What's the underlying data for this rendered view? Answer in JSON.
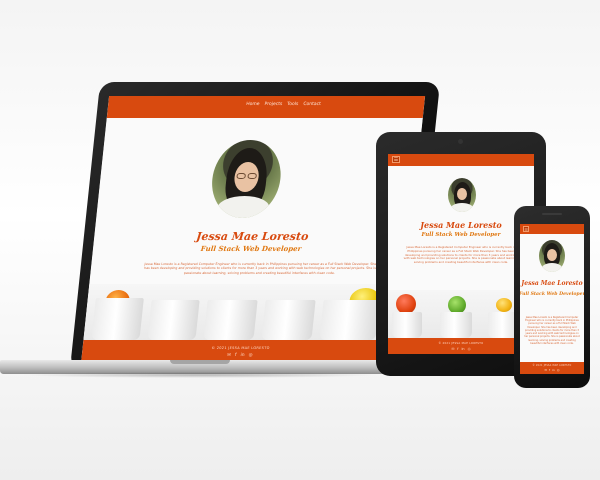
{
  "site": {
    "name": "Jessa Mae Loresto",
    "role": "Full Stack Web Developer",
    "nav": [
      "Home",
      "Projects",
      "Tools",
      "Contact"
    ],
    "menu_icon": "hamburger-icon",
    "description": "Jessa Mae Loresto is a Registered Computer Engineer who is currently back in Philippines pursuing her career as a Full Stack Web Developer. She has been developing and providing solutions to clients for more than 3 years and working with web technologies on her personal projects. She is passionate about learning, solving problems and creating beautiful interfaces with clean code.",
    "copyright": "© 2021 JESSA MAE LORESTO",
    "social_icons": [
      "email-icon",
      "facebook-icon",
      "linkedin-icon",
      "github-icon"
    ],
    "social_glyphs": [
      "✉",
      "f",
      "in",
      "◎"
    ]
  },
  "colors": {
    "accent": "#d84a0f",
    "role": "#e07812",
    "page": "#fafafa",
    "bezel": "#1a1a1a"
  }
}
